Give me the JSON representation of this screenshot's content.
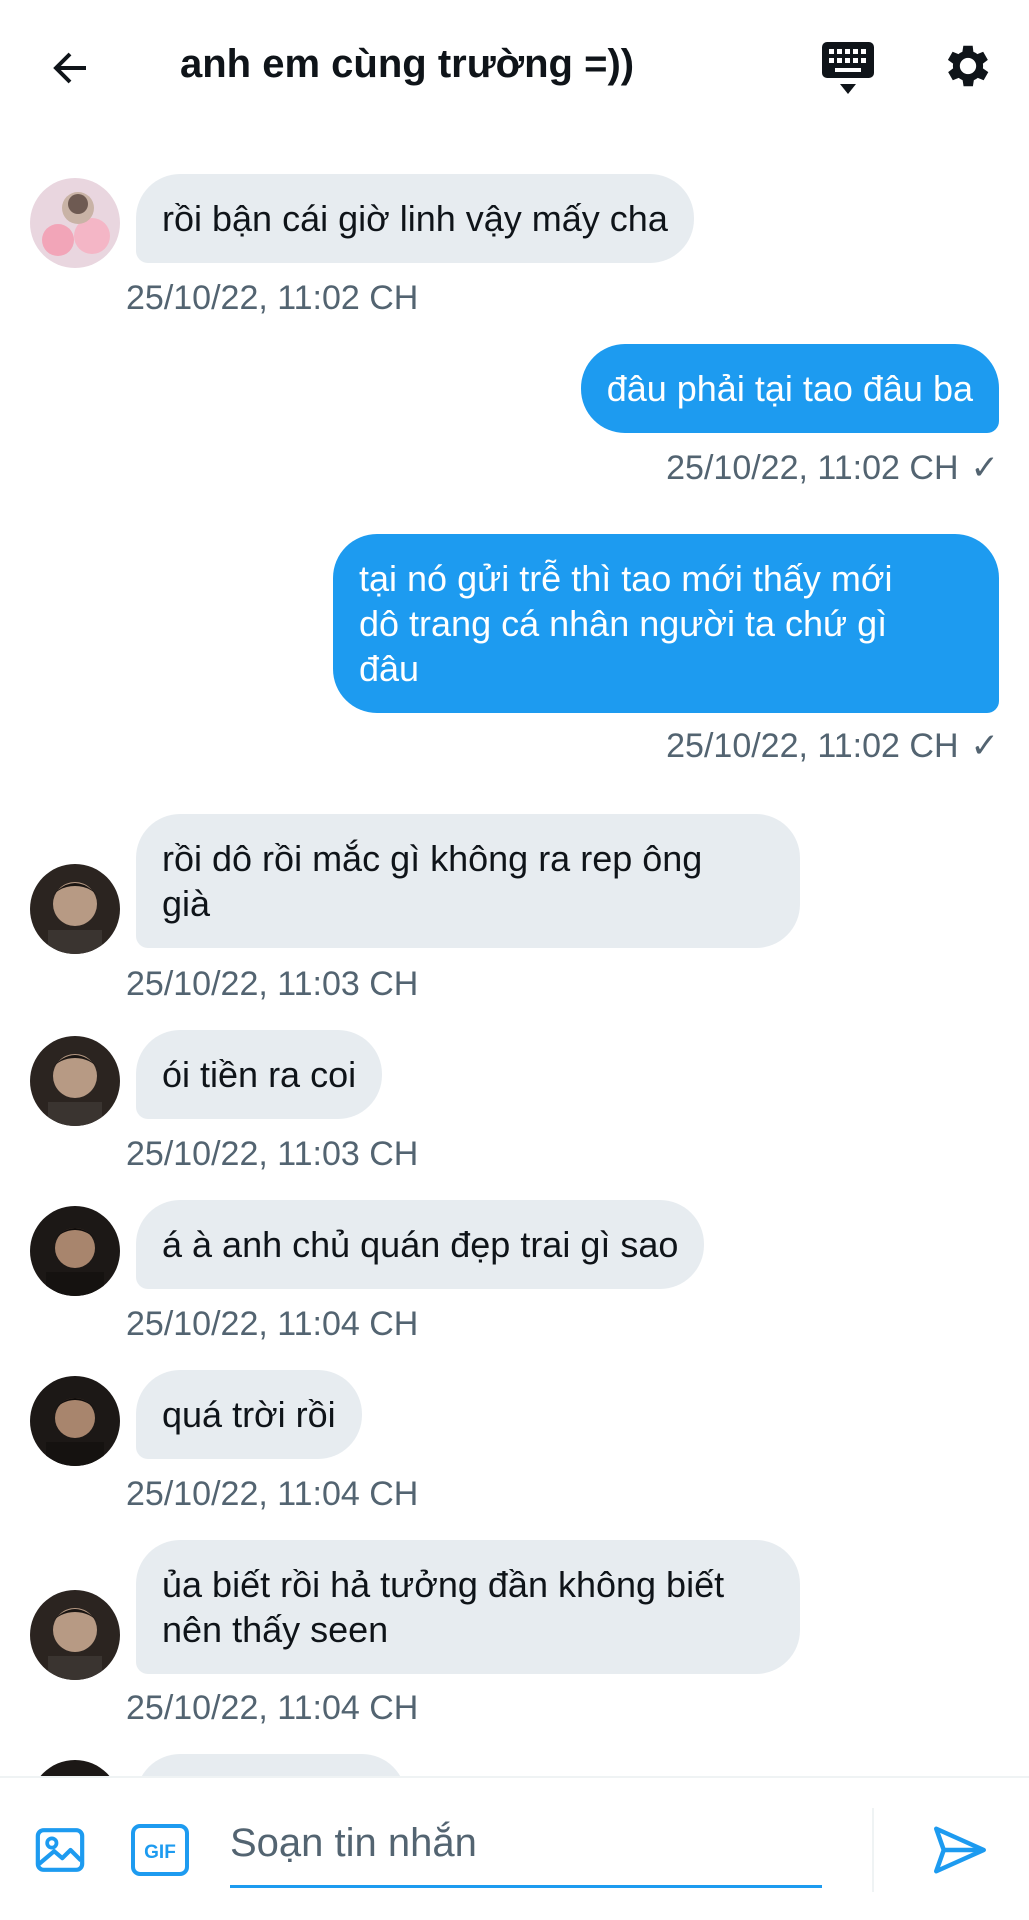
{
  "header": {
    "title": "anh em cùng trường =))",
    "back_icon": "arrow-left-icon",
    "keyboard_icon": "keyboard-icon",
    "settings_icon": "gear-icon"
  },
  "messages": [
    {
      "side": "in",
      "text": "rồi bận cái giờ linh vậy mấy cha",
      "time": "25/10/22, 11:02 CH"
    },
    {
      "side": "out",
      "text": "đâu phải tại tao đâu ba",
      "time": "25/10/22, 11:02 CH",
      "status": "✓"
    },
    {
      "side": "out",
      "text": "tại nó gửi trễ thì tao mới thấy mới\ndô trang cá nhân người ta chứ gì\nđâu",
      "time": "25/10/22, 11:02 CH",
      "status": "✓"
    },
    {
      "side": "in",
      "text": "rồi dô rồi mắc gì không ra rep ông\ngià",
      "time": "25/10/22, 11:03 CH"
    },
    {
      "side": "in",
      "text": "ói tiền ra coi",
      "time": "25/10/22, 11:03 CH"
    },
    {
      "side": "in",
      "text": "á à anh chủ quán đẹp trai gì sao",
      "time": "25/10/22, 11:04 CH"
    },
    {
      "side": "in",
      "text": "quá trời rồi",
      "time": "25/10/22, 11:04 CH"
    },
    {
      "side": "in",
      "text": "ủa biết rồi hả tưởng đần không biết\nnên thấy seen",
      "time": "25/10/22, 11:04 CH"
    }
  ],
  "composer": {
    "placeholder": "Soạn tin nhắn",
    "value": "",
    "image_icon": "image-icon",
    "gif_icon": "gif-icon",
    "send_icon": "send-icon",
    "gif_label": "GIF"
  },
  "colors": {
    "accent": "#1d9bf0",
    "incoming_bubble": "#e7ecf0",
    "secondary_text": "#536471"
  }
}
